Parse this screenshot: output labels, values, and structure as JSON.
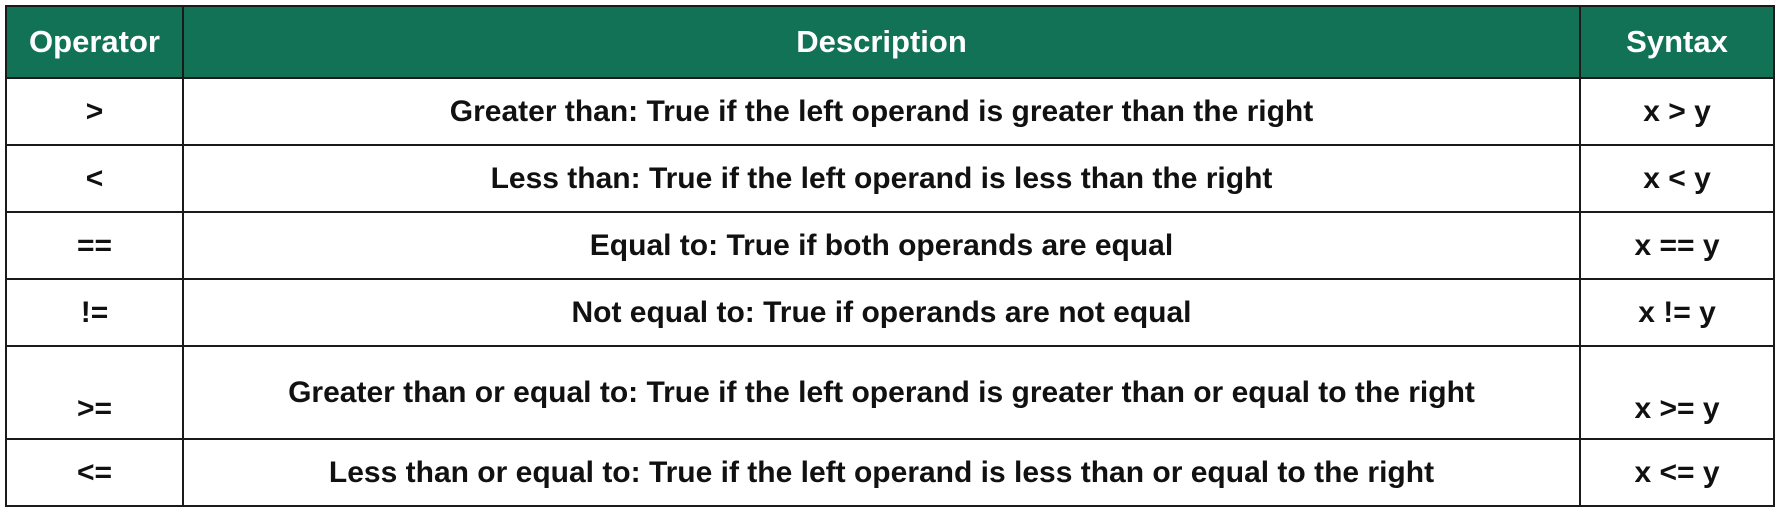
{
  "header": {
    "operator": "Operator",
    "description": "Description",
    "syntax": "Syntax"
  },
  "colors": {
    "header_bg": "#117256",
    "header_text": "#ffffff",
    "border": "#1a1a1a",
    "cell_text": "#111111"
  },
  "rows": [
    {
      "operator": ">",
      "description": "Greater than: True if the left operand is greater than the right",
      "syntax": "x > y"
    },
    {
      "operator": "<",
      "description": "Less than: True if the left operand is less than the right",
      "syntax": "x < y"
    },
    {
      "operator": "==",
      "description": "Equal to: True if both operands are equal",
      "syntax": "x == y"
    },
    {
      "operator": "!=",
      "description": "Not equal to: True if operands are not equal",
      "syntax": "x != y"
    },
    {
      "operator": ">=",
      "description": "Greater than or equal to: True if the left operand is greater than or equal to the right",
      "syntax": "x >= y"
    },
    {
      "operator": "<=",
      "description": "Less than or equal to: True if the left operand is less than or equal to the right",
      "syntax": "x <= y"
    }
  ]
}
